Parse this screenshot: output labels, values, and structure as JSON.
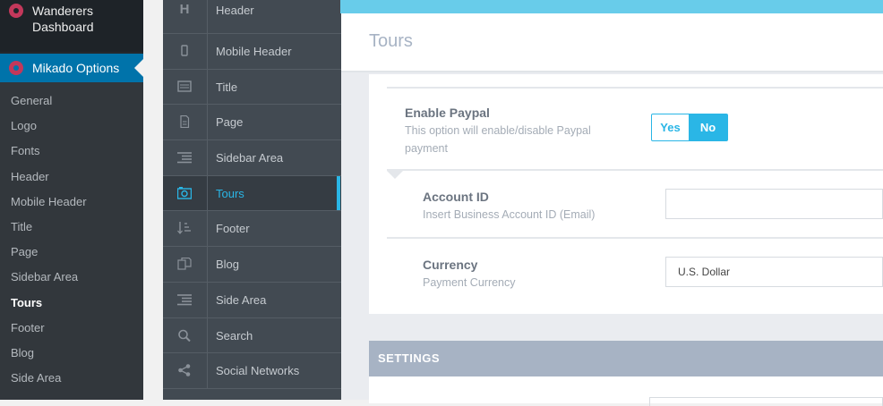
{
  "wp_menu": {
    "site_name": "Wanderers Dashboard",
    "current_menu": "Mikado Options",
    "submenu": [
      "General",
      "Logo",
      "Fonts",
      "Header",
      "Mobile Header",
      "Title",
      "Page",
      "Sidebar Area",
      "Tours",
      "Footer",
      "Blog",
      "Side Area"
    ],
    "active_submenu": "Tours"
  },
  "mikado_nav": {
    "items": [
      {
        "label": "Header",
        "icon": "header-h-icon"
      },
      {
        "label": "Mobile Header",
        "icon": "mobile-phone-icon"
      },
      {
        "label": "Title",
        "icon": "title-window-icon"
      },
      {
        "label": "Page",
        "icon": "page-document-icon"
      },
      {
        "label": "Sidebar Area",
        "icon": "sidebar-lines-icon"
      },
      {
        "label": "Tours",
        "icon": "tours-camera-icon"
      },
      {
        "label": "Footer",
        "icon": "footer-sort-icon"
      },
      {
        "label": "Blog",
        "icon": "blog-copy-icon"
      },
      {
        "label": "Side Area",
        "icon": "side-area-lines-icon"
      },
      {
        "label": "Search",
        "icon": "search-icon"
      },
      {
        "label": "Social Networks",
        "icon": "share-icon"
      }
    ],
    "active_index": 5
  },
  "page": {
    "title": "Tours"
  },
  "fields": {
    "paypal": {
      "title": "Enable Paypal",
      "desc_line1": "This option will enable/disable Paypal",
      "desc_line2": "payment",
      "yes_label": "Yes",
      "no_label": "No",
      "selected": "No"
    },
    "account": {
      "title": "Account ID",
      "desc": "Insert Business Account ID (Email)",
      "value": ""
    },
    "currency": {
      "title": "Currency",
      "desc": "Payment Currency",
      "value": "U.S. Dollar"
    }
  },
  "settings": {
    "heading": "SETTINGS"
  },
  "colors": {
    "accent": "#2ab6e6",
    "wp_active": "#0073aa",
    "heading_bar": "#a7b3c4"
  }
}
